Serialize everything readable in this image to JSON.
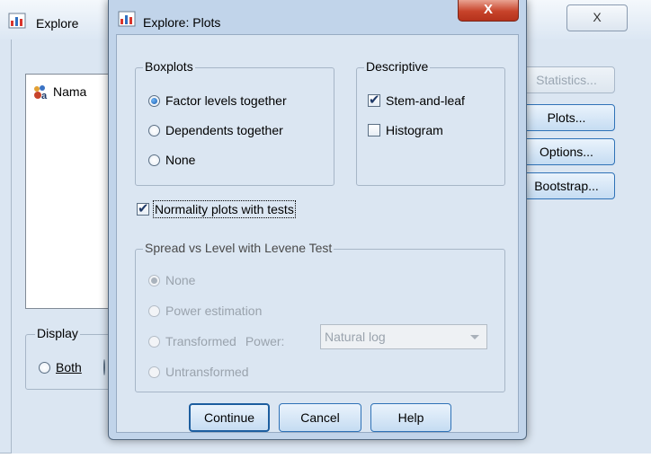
{
  "background_window": {
    "title": "Explore",
    "close_glyph": "X",
    "variable_list": [
      {
        "label": "Nama",
        "icon": "nominal-string-variable-icon"
      }
    ],
    "display_group": {
      "legend": "Display",
      "options": [
        {
          "label": "Both",
          "selected": false
        }
      ]
    },
    "side_buttons": [
      {
        "label": "Statistics...",
        "enabled": false
      },
      {
        "label": "Plots...",
        "enabled": true
      },
      {
        "label": "Options...",
        "enabled": true
      },
      {
        "label": "Bootstrap...",
        "enabled": true
      }
    ]
  },
  "dialog": {
    "title": "Explore: Plots",
    "close_glyph": "X",
    "boxplots": {
      "legend": "Boxplots",
      "options": [
        {
          "label": "Factor levels together",
          "selected": true
        },
        {
          "label": "Dependents together",
          "selected": false
        },
        {
          "label": "None",
          "selected": false
        }
      ]
    },
    "descriptive": {
      "legend": "Descriptive",
      "options": [
        {
          "label": "Stem-and-leaf",
          "checked": true
        },
        {
          "label": "Histogram",
          "checked": false
        }
      ]
    },
    "normality": {
      "label": "Normality plots with tests",
      "checked": true
    },
    "spread_vs_level": {
      "legend": "Spread vs Level with Levene Test",
      "enabled": false,
      "options": [
        {
          "label": "None",
          "selected": true
        },
        {
          "label": "Power estimation",
          "selected": false
        },
        {
          "label": "Transformed",
          "selected": false
        },
        {
          "label": "Untransformed",
          "selected": false
        }
      ],
      "power_label": "Power:",
      "power_value": "Natural log"
    },
    "buttons": {
      "continue": "Continue",
      "cancel": "Cancel",
      "help": "Help"
    }
  },
  "colors": {
    "window_bg": "#dbe6f2",
    "button_border": "#2f72b7",
    "close_red": "#c7432a",
    "disabled_text": "#9aa3ad"
  }
}
